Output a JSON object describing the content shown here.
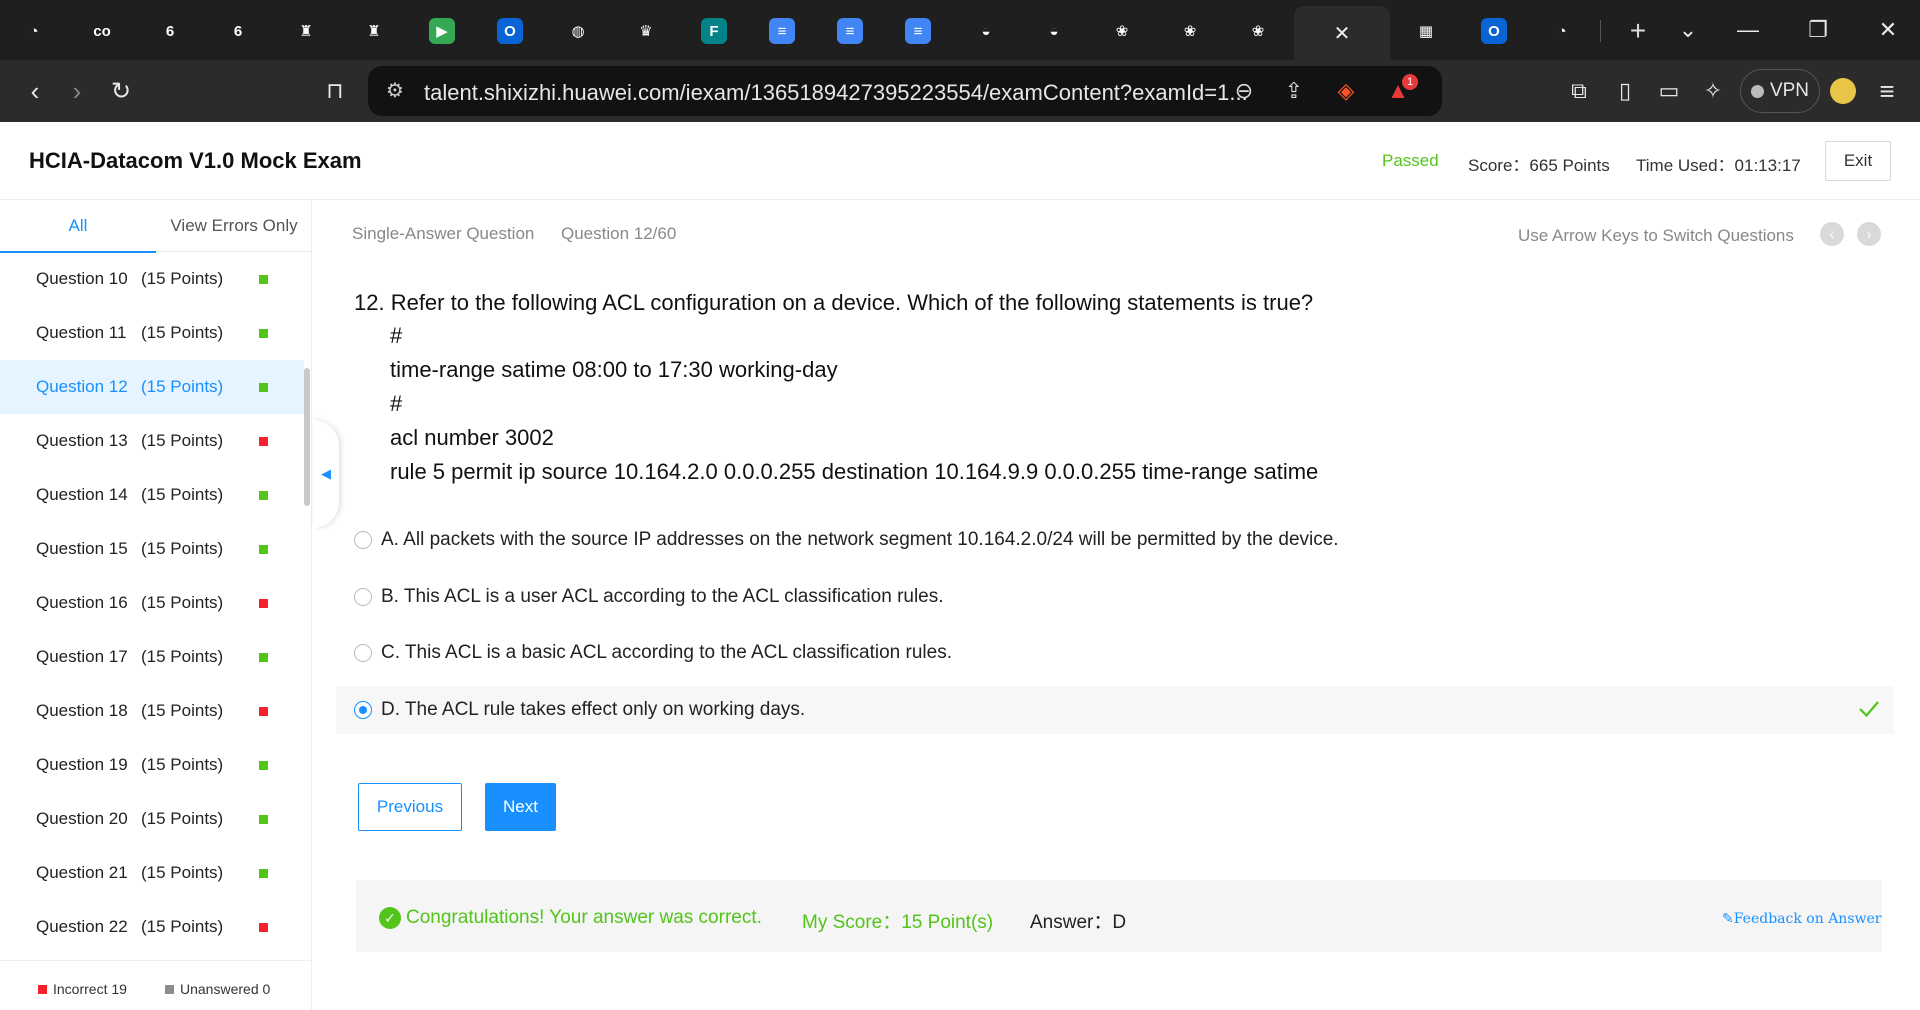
{
  "browser": {
    "tabs": [
      {
        "icon": "speedometer-icon",
        "glyph": "◔",
        "color": "#1f1f1f"
      },
      {
        "icon": "coursera-icon",
        "glyph": "co",
        "color": "#1f1f1f"
      },
      {
        "icon": "six-icon",
        "glyph": "6",
        "color": "#1f1f1f"
      },
      {
        "icon": "six-icon",
        "glyph": "6",
        "color": "#1f1f1f"
      },
      {
        "icon": "university-crest-icon",
        "glyph": "♜",
        "color": "#1f1f1f"
      },
      {
        "icon": "university-crest-icon",
        "glyph": "♜",
        "color": "#1f1f1f"
      },
      {
        "icon": "google-meet-icon",
        "glyph": "▶",
        "color": "#34a853"
      },
      {
        "icon": "outlook-icon",
        "glyph": "O",
        "color": "#0a64d6"
      },
      {
        "icon": "globe-icon",
        "glyph": "◍",
        "color": "#1f1f1f"
      },
      {
        "icon": "crest-icon",
        "glyph": "♛",
        "color": "#1f1f1f"
      },
      {
        "icon": "forms-icon",
        "glyph": "F",
        "color": "#038387"
      },
      {
        "icon": "google-docs-icon",
        "glyph": "≡",
        "color": "#4285f4"
      },
      {
        "icon": "google-docs-icon",
        "glyph": "≡",
        "color": "#4285f4"
      },
      {
        "icon": "google-docs-icon",
        "glyph": "≡",
        "color": "#4285f4"
      },
      {
        "icon": "deepseek-icon",
        "glyph": "◒",
        "color": "#1f1f1f"
      },
      {
        "icon": "deepseek-icon",
        "glyph": "◒",
        "color": "#1f1f1f"
      },
      {
        "icon": "huawei-icon",
        "glyph": "❀",
        "color": "#1f1f1f"
      },
      {
        "icon": "huawei-icon",
        "glyph": "❀",
        "color": "#1f1f1f"
      },
      {
        "icon": "huawei-icon",
        "glyph": "❀",
        "color": "#1f1f1f"
      }
    ],
    "active_tab_glyph": "✕",
    "after_tabs": [
      {
        "icon": "microsoft-icon",
        "glyph": "▦",
        "color": "#1f1f1f"
      },
      {
        "icon": "outlook-icon",
        "glyph": "O",
        "color": "#0a64d6"
      },
      {
        "icon": "speedometer-icon",
        "glyph": "◔",
        "color": "#1f1f1f"
      }
    ],
    "new_tab_glyph": "+",
    "url": "talent.shixizhi.huawei.com/iexam/1365189427395223554/examContent?examId=1...",
    "vpn_label": "VPN",
    "brave_badge": "1"
  },
  "header": {
    "title": "HCIA-Datacom V1.0 Mock Exam",
    "status": "Passed",
    "score": "Score：665 Points",
    "time_used": "Time Used：01:13:17",
    "exit_label": "Exit"
  },
  "sidebar": {
    "tab_all": "All",
    "tab_errors": "View Errors Only",
    "questions": [
      {
        "name": "Question 10",
        "points": "(15 Points)",
        "status": "correct",
        "active": false
      },
      {
        "name": "Question 11",
        "points": "(15 Points)",
        "status": "correct",
        "active": false
      },
      {
        "name": "Question 12",
        "points": "(15 Points)",
        "status": "correct",
        "active": true
      },
      {
        "name": "Question 13",
        "points": "(15 Points)",
        "status": "incorrect",
        "active": false
      },
      {
        "name": "Question 14",
        "points": "(15 Points)",
        "status": "correct",
        "active": false
      },
      {
        "name": "Question 15",
        "points": "(15 Points)",
        "status": "correct",
        "active": false
      },
      {
        "name": "Question 16",
        "points": "(15 Points)",
        "status": "incorrect",
        "active": false
      },
      {
        "name": "Question 17",
        "points": "(15 Points)",
        "status": "correct",
        "active": false
      },
      {
        "name": "Question 18",
        "points": "(15 Points)",
        "status": "incorrect",
        "active": false
      },
      {
        "name": "Question 19",
        "points": "(15 Points)",
        "status": "correct",
        "active": false
      },
      {
        "name": "Question 20",
        "points": "(15 Points)",
        "status": "correct",
        "active": false
      },
      {
        "name": "Question 21",
        "points": "(15 Points)",
        "status": "correct",
        "active": false
      },
      {
        "name": "Question 22",
        "points": "(15 Points)",
        "status": "incorrect",
        "active": false
      }
    ],
    "legend_incorrect": "Incorrect 19",
    "legend_unanswered": "Unanswered 0"
  },
  "colors": {
    "accent": "#1890ff",
    "correct": "#52c41a",
    "incorrect": "#f5222d",
    "unanswered": "#8c8c8c"
  },
  "question": {
    "type": "Single-Answer Question",
    "number": "Question 12/60",
    "arrow_hint": "Use Arrow Keys to Switch Questions",
    "stem": "12. Refer to the following ACL configuration on a device. Which of the following statements is true?",
    "code": [
      "#",
      "time-range satime 08:00 to 17:30 working-day",
      "#",
      "acl number 3002",
      "rule 5 permit ip source 10.164.2.0 0.0.0.255 destination 10.164.9.9 0.0.0.255 time-range satime"
    ],
    "options": [
      {
        "text": "A. All packets with the source IP addresses on the network segment 10.164.2.0/24 will be permitted by the device.",
        "selected": false
      },
      {
        "text": "B. This ACL is a user ACL according to the ACL classification rules.",
        "selected": false
      },
      {
        "text": "C. This ACL is a basic ACL according to the ACL classification rules.",
        "selected": false
      },
      {
        "text": "D. The ACL rule takes effect only on working days.",
        "selected": true
      }
    ],
    "prev_label": "Previous",
    "next_label": "Next"
  },
  "result": {
    "message": "Congratulations! Your answer was correct.",
    "my_score": "My Score：15 Point(s)",
    "answer": "Answer：D",
    "feedback": "Feedback on Answer"
  }
}
